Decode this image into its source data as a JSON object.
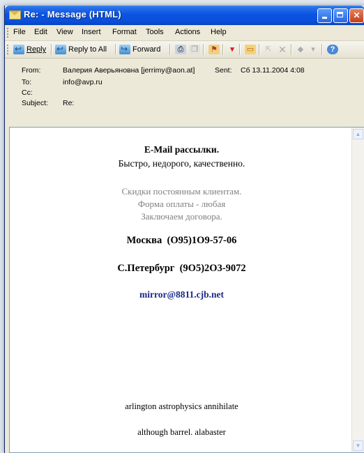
{
  "window": {
    "title": "Re: - Message (HTML)"
  },
  "menu": [
    {
      "label": "File"
    },
    {
      "label": "Edit"
    },
    {
      "label": "View"
    },
    {
      "label": "Insert"
    },
    {
      "label": "Format"
    },
    {
      "label": "Tools"
    },
    {
      "label": "Actions"
    },
    {
      "label": "Help"
    }
  ],
  "toolbar": {
    "reply_label": "Reply",
    "reply_all_label": "Reply to All",
    "forward_label": "Forward"
  },
  "header": {
    "from_label": "From:",
    "from_value": "Валерия Аверьяновна [jerrimy@aon.at]",
    "sent_label": "Sent:",
    "sent_value": "Сб 13.11.2004 4:08",
    "to_label": "To:",
    "to_value": "info@avp.ru",
    "cc_label": "Cc:",
    "subject_label": "Subject:",
    "subject_value": "Re:"
  },
  "message": {
    "title": "E-Mail рассылки.",
    "subtitle": "Быстро, недорого, качественно.",
    "grey_lines": [
      "Скидки постоянным клиентам.",
      "Форма оплаты - любая",
      "Заключаем договора."
    ],
    "moscow": "Москва  (О95)1О9-57-06",
    "spb": "С.Петербург  (9О5)2О3-9072",
    "email": "mirror@8811.cjb.net",
    "footer1": "arlington astrophysics annihilate",
    "footer2": "although barrel. alabaster"
  },
  "colors": {
    "titlebar": "#0a54e4",
    "link": "#1a2a8a",
    "grey_text": "#808080"
  }
}
